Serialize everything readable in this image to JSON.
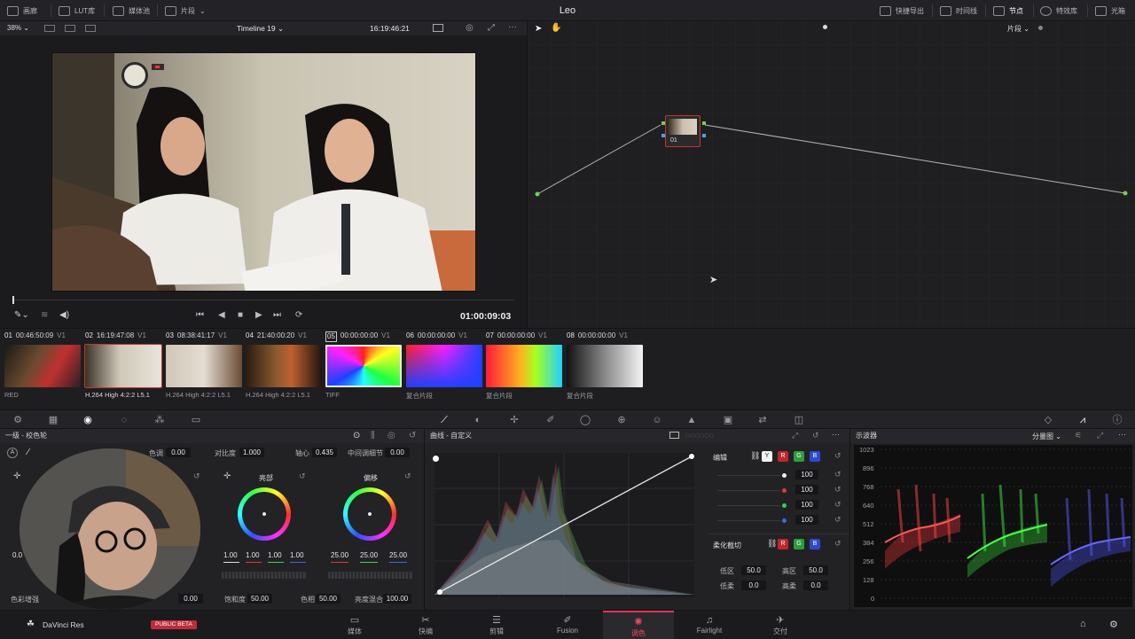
{
  "topbar": {
    "left": [
      "画廊",
      "LUT库",
      "媒体池",
      "片段"
    ],
    "title": "Leo",
    "right": [
      "快捷导出",
      "时间线",
      "节点",
      "特效库",
      "光箱"
    ]
  },
  "viewer": {
    "zoom": "38%",
    "timeline": "Timeline 19",
    "timecode_top": "16:19:46:21",
    "timecode": "01:00:09:03"
  },
  "nodes": {
    "mode": "片段",
    "node_label": "01"
  },
  "clips": [
    {
      "num": "01",
      "tc": "00:46:50:09",
      "track": "V1",
      "codec": "RED"
    },
    {
      "num": "02",
      "tc": "16:19:47:08",
      "track": "V1",
      "codec": "H.264 High 4:2:2 L5.1"
    },
    {
      "num": "03",
      "tc": "08:38:41:17",
      "track": "V1",
      "codec": "H.264 High 4:2:2 L5.1"
    },
    {
      "num": "04",
      "tc": "21:40:00:20",
      "track": "V1",
      "codec": "H.264 High 4:2:2 L5.1"
    },
    {
      "num": "05",
      "tc": "00:00:00:00",
      "track": "V1",
      "codec": "TIFF"
    },
    {
      "num": "06",
      "tc": "00:00:00:00",
      "track": "V1",
      "codec": "复合片段"
    },
    {
      "num": "07",
      "tc": "00:00:00:00",
      "track": "V1",
      "codec": "复合片段"
    },
    {
      "num": "08",
      "tc": "00:00:00:00",
      "track": "V1",
      "codec": "复合片段"
    }
  ],
  "primary": {
    "title": "一级 - 校色轮",
    "color_temp_label": "色调",
    "color_temp": "0.00",
    "contrast_label": "对比度",
    "contrast": "1.000",
    "pivot_label": "轴心",
    "pivot": "0.435",
    "middetail_label": "中间调细节",
    "middetail": "0.00",
    "wheel_gain_label": "亮部",
    "wheel_gain_values": [
      "1.00",
      "1.00",
      "1.00",
      "1.00"
    ],
    "wheel_offset_label": "偏移",
    "wheel_offset_values": [
      "25.00",
      "25.00",
      "25.00"
    ],
    "left_value": "0.0",
    "colorboost_label": "色彩增强",
    "colorboost": "0.00",
    "saturation_label": "饱和度",
    "saturation": "50.00",
    "hue_label": "色相",
    "hue": "50.00",
    "lummix_label": "亮度混合",
    "lummix": "100.00"
  },
  "curves": {
    "title": "曲线 - 自定义",
    "edit_label": "编辑",
    "channels": [
      "Y",
      "R",
      "G",
      "B"
    ],
    "intensities": [
      "100",
      "100",
      "100",
      "100"
    ],
    "softclip_label": "柔化截切",
    "low_label": "低区",
    "low": "50.0",
    "high_label": "高区",
    "high": "50.0",
    "lowsoft_label": "低柔",
    "lowsoft": "0.0",
    "highsoft_label": "高柔",
    "highsoft": "0.0"
  },
  "scope": {
    "title": "示波器",
    "mode": "分量图",
    "ticks": [
      "1023",
      "896",
      "768",
      "640",
      "512",
      "384",
      "256",
      "128",
      "0"
    ]
  },
  "pagebar": {
    "brand": "DaVinci Res",
    "badge": "PUBLIC BETA",
    "pages": [
      "媒体",
      "快编",
      "剪辑",
      "Fusion",
      "调色",
      "Fairlight",
      "交付"
    ],
    "active": "调色"
  }
}
